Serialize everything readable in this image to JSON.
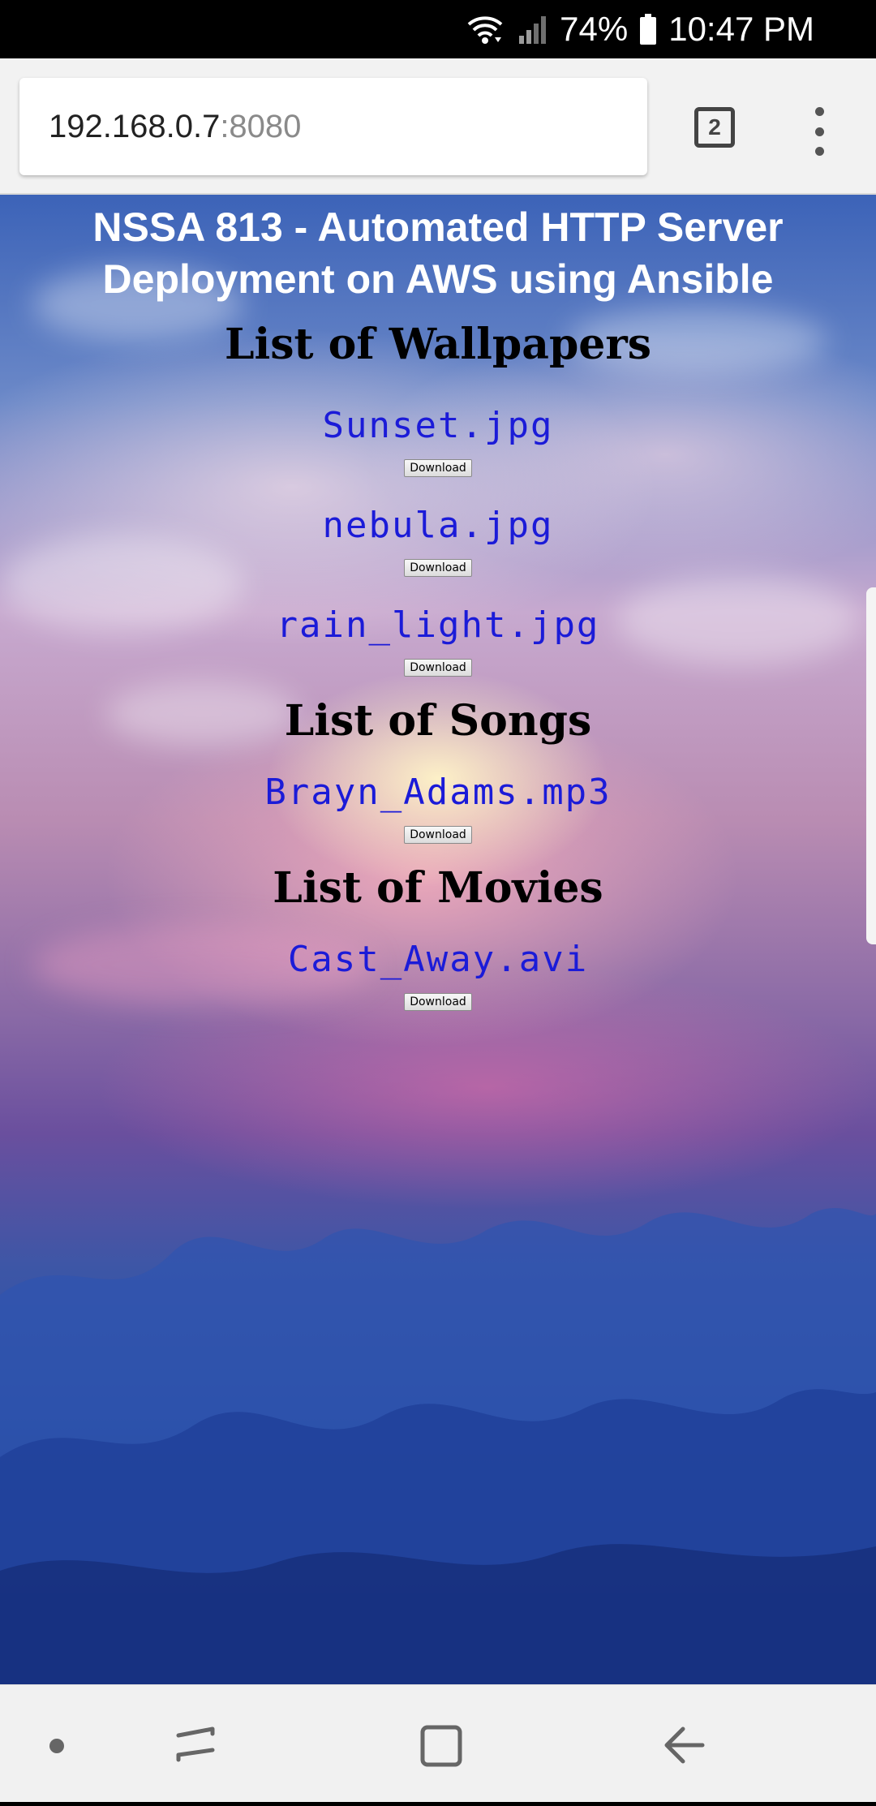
{
  "status_bar": {
    "battery_percent": "74%",
    "time": "10:47 PM",
    "icons": [
      "wifi-icon",
      "signal-icon",
      "battery-icon"
    ]
  },
  "browser": {
    "url_host": "192.168.0.7",
    "url_port": ":8080",
    "tab_count": "2",
    "menu_icon": "more-vertical-icon"
  },
  "page": {
    "title_line1": "NSSA 813 - Automated HTTP Server",
    "title_line2": "Deployment on AWS using Ansible",
    "sections": [
      {
        "heading": "List of Wallpapers",
        "files": [
          "Sunset.jpg",
          "nebula.jpg",
          "rain_light.jpg"
        ]
      },
      {
        "heading": "List of Songs",
        "files": [
          "Brayn_Adams.mp3"
        ]
      },
      {
        "heading": "List of Movies",
        "files": [
          "Cast_Away.avi"
        ]
      }
    ],
    "download_label": "Download",
    "link_color": "#1b1bd8"
  },
  "nav_bar": {
    "icons": [
      "dot-icon",
      "recents-icon",
      "home-icon",
      "back-icon"
    ]
  }
}
